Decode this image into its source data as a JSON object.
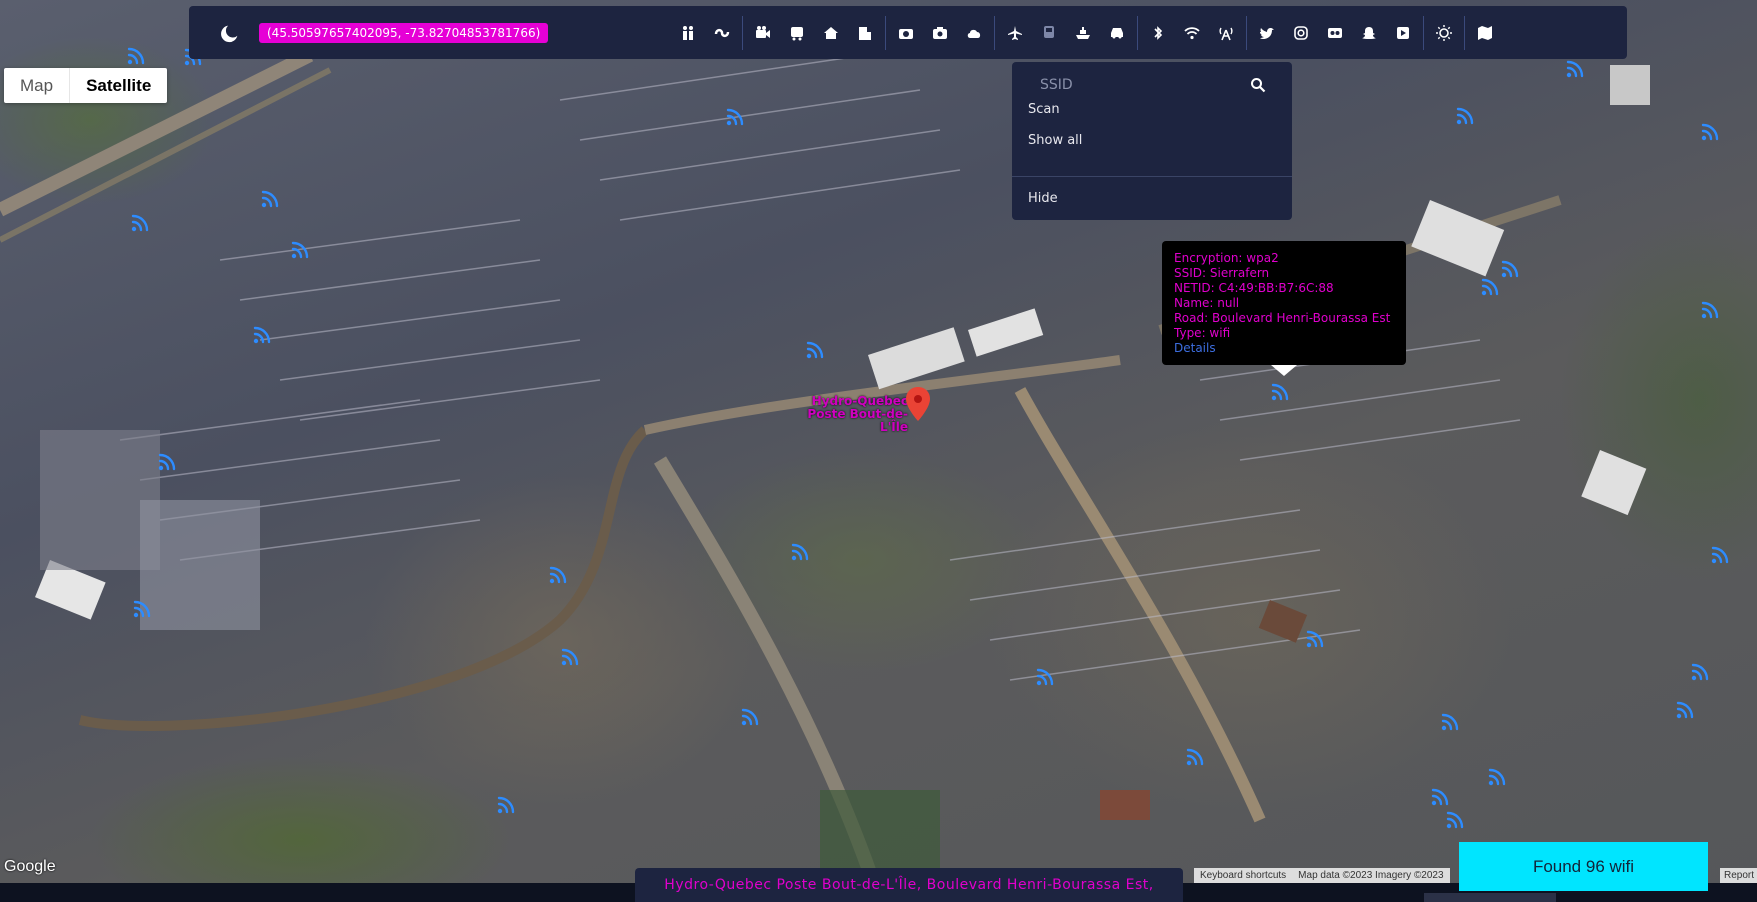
{
  "toolbar": {
    "coords": "(45.50597657402095, -73.82704853781766)",
    "theme_icon": "moon-icon",
    "groups": [
      [
        "people-icon",
        "worm-icon"
      ],
      [
        "video-camera-icon",
        "bus-icon",
        "house-icon",
        "building-icon"
      ],
      [
        "camera-icon",
        "camera-alt-icon",
        "cloud-icon"
      ],
      [
        "plane-icon",
        "train-icon",
        "ship-icon",
        "car-icon"
      ],
      [
        "bluetooth-icon",
        "wifi-icon",
        "tower-icon"
      ],
      [
        "twitter-icon",
        "instagram-icon",
        "flickr-icon",
        "snapchat-icon",
        "youtube-icon"
      ],
      [
        "sun-icon"
      ],
      [
        "map-icon"
      ]
    ]
  },
  "map_type": {
    "map": "Map",
    "satellite": "Satellite",
    "selected": "Satellite"
  },
  "dropdown": {
    "placeholder": "SSID",
    "value": "",
    "scan": "Scan",
    "show_all": "Show all",
    "hide": "Hide"
  },
  "infowindow": {
    "encryption": "Encryption: wpa2",
    "ssid": "SSID: Sierrafern",
    "netid": "NETID: C4:49:BB:B7:6C:88",
    "name": "Name: null",
    "road": "Road: Boulevard Henri-Bourassa Est",
    "type": "Type: wifi",
    "details": "Details"
  },
  "marker": {
    "label": "Hydro-Quebec Poste Bout-de-L'Île"
  },
  "address": "Hydro-Quebec Poste Bout-de-L'Île, Boulevard Henri-Bourassa Est,",
  "found": "Found 96 wifi",
  "google": "Google",
  "attribution": {
    "shortcuts": "Keyboard shortcuts",
    "map_data": "Map data ©2023 Imagery ©2023",
    "report": "Report"
  },
  "colors": {
    "accent": "#e600d6",
    "panel": "#1d2440",
    "found": "#00e5ff",
    "wifi": "#2d8cff"
  }
}
